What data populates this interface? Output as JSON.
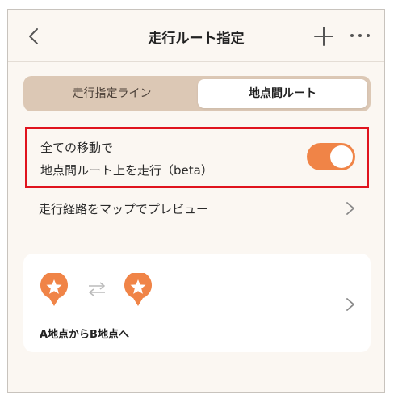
{
  "header": {
    "title": "走行ルート指定"
  },
  "segmented": {
    "tab_a": "走行指定ライン",
    "tab_b": "地点間ルート",
    "selected": "地点間ルート"
  },
  "option": {
    "line1": "全ての移動で",
    "line2": "地点間ルート上を走行（beta）",
    "toggle_on": true
  },
  "preview": {
    "label": "走行経路をマップでプレビュー"
  },
  "route_card": {
    "label": "A地点からB地点へ"
  },
  "colors": {
    "accent": "#f08447",
    "segment_bg": "#dcc8b5",
    "highlight_border": "#e0141e",
    "page_bg": "#fbf7f2"
  },
  "icons": [
    "back-arrow-icon",
    "plus-icon",
    "more-icon",
    "chevron-right-icon",
    "star-pin-icon",
    "swap-arrows-icon"
  ]
}
